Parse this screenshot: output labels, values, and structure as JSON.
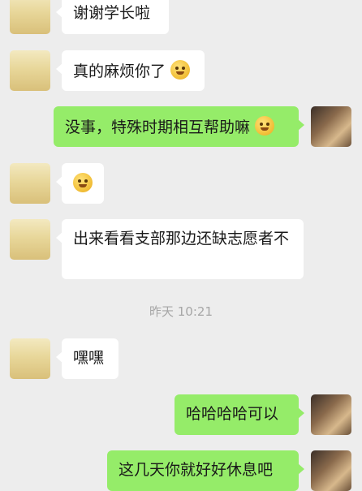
{
  "chat": {
    "timestamp": "昨天 10:21",
    "messages": [
      {
        "side": "in",
        "text": "谢谢学长啦",
        "emoji": ""
      },
      {
        "side": "in",
        "text": "真的麻烦你了",
        "emoji": "tearful-smile-emoji"
      },
      {
        "side": "out",
        "text": "没事，特殊时期相互帮助嘛",
        "emoji": "thinking-emoji"
      },
      {
        "side": "in",
        "text": "",
        "emoji": "emoji-sticker"
      },
      {
        "side": "in",
        "text": "出来看看支部那边还缺志愿者不",
        "emoji": ""
      },
      {
        "side": "in",
        "text": "嘿嘿",
        "emoji": ""
      },
      {
        "side": "out",
        "text": "哈哈哈哈可以",
        "emoji": ""
      },
      {
        "side": "out",
        "text": "这几天你就好好休息吧",
        "emoji": ""
      }
    ]
  },
  "colors": {
    "background": "#ededed",
    "incoming_bubble": "#ffffff",
    "outgoing_bubble": "#95ec69",
    "timestamp_text": "#a6a6a6"
  }
}
